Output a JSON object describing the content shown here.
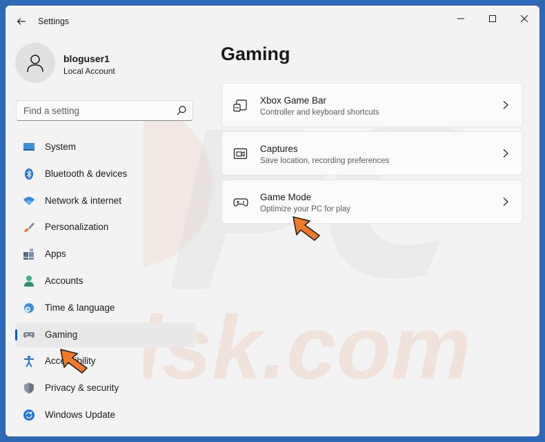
{
  "window": {
    "title": "Settings"
  },
  "profile": {
    "name": "bloguser1",
    "account_type": "Local Account"
  },
  "search": {
    "placeholder": "Find a setting"
  },
  "nav": {
    "items": [
      {
        "label": "System",
        "icon": "monitor-icon"
      },
      {
        "label": "Bluetooth & devices",
        "icon": "bluetooth-icon"
      },
      {
        "label": "Network & internet",
        "icon": "wifi-icon"
      },
      {
        "label": "Personalization",
        "icon": "brush-icon"
      },
      {
        "label": "Apps",
        "icon": "apps-icon"
      },
      {
        "label": "Accounts",
        "icon": "person-icon"
      },
      {
        "label": "Time & language",
        "icon": "globe-clock-icon"
      },
      {
        "label": "Gaming",
        "icon": "gamepad-icon",
        "selected": true
      },
      {
        "label": "Accessibility",
        "icon": "accessibility-icon"
      },
      {
        "label": "Privacy & security",
        "icon": "shield-icon"
      },
      {
        "label": "Windows Update",
        "icon": "update-icon"
      }
    ]
  },
  "main": {
    "title": "Gaming",
    "cards": [
      {
        "title": "Xbox Game Bar",
        "subtitle": "Controller and keyboard shortcuts",
        "icon": "game-bar-icon"
      },
      {
        "title": "Captures",
        "subtitle": "Save location, recording preferences",
        "icon": "capture-icon"
      },
      {
        "title": "Game Mode",
        "subtitle": "Optimize your PC for play",
        "icon": "game-mode-icon"
      }
    ]
  },
  "colors": {
    "accent": "#005fb8",
    "desktop": "#2f68b4",
    "window_bg": "#f3f3f3",
    "arrow": "#f07a2a"
  }
}
